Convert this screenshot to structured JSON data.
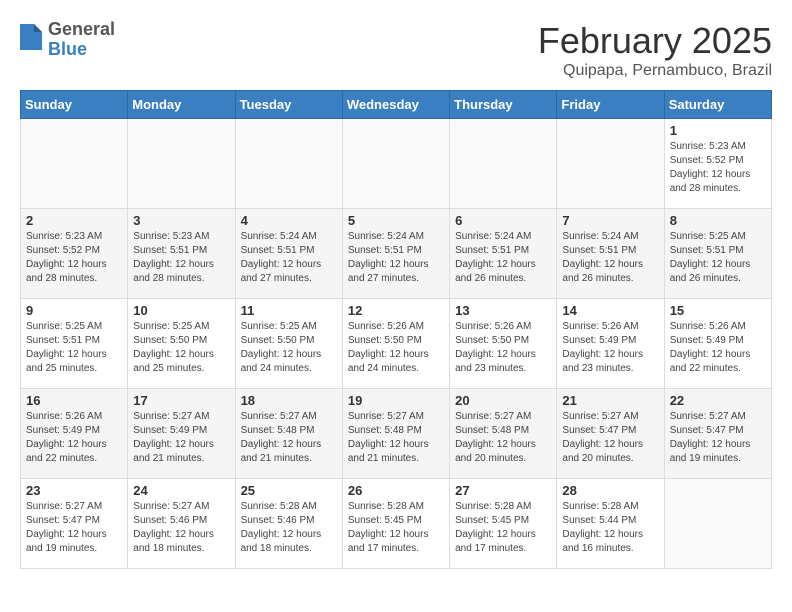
{
  "header": {
    "logo_general": "General",
    "logo_blue": "Blue",
    "month_title": "February 2025",
    "location": "Quipapa, Pernambuco, Brazil"
  },
  "weekdays": [
    "Sunday",
    "Monday",
    "Tuesday",
    "Wednesday",
    "Thursday",
    "Friday",
    "Saturday"
  ],
  "weeks": [
    [
      {
        "day": "",
        "info": ""
      },
      {
        "day": "",
        "info": ""
      },
      {
        "day": "",
        "info": ""
      },
      {
        "day": "",
        "info": ""
      },
      {
        "day": "",
        "info": ""
      },
      {
        "day": "",
        "info": ""
      },
      {
        "day": "1",
        "info": "Sunrise: 5:23 AM\nSunset: 5:52 PM\nDaylight: 12 hours and 28 minutes."
      }
    ],
    [
      {
        "day": "2",
        "info": "Sunrise: 5:23 AM\nSunset: 5:52 PM\nDaylight: 12 hours and 28 minutes."
      },
      {
        "day": "3",
        "info": "Sunrise: 5:23 AM\nSunset: 5:51 PM\nDaylight: 12 hours and 28 minutes."
      },
      {
        "day": "4",
        "info": "Sunrise: 5:24 AM\nSunset: 5:51 PM\nDaylight: 12 hours and 27 minutes."
      },
      {
        "day": "5",
        "info": "Sunrise: 5:24 AM\nSunset: 5:51 PM\nDaylight: 12 hours and 27 minutes."
      },
      {
        "day": "6",
        "info": "Sunrise: 5:24 AM\nSunset: 5:51 PM\nDaylight: 12 hours and 26 minutes."
      },
      {
        "day": "7",
        "info": "Sunrise: 5:24 AM\nSunset: 5:51 PM\nDaylight: 12 hours and 26 minutes."
      },
      {
        "day": "8",
        "info": "Sunrise: 5:25 AM\nSunset: 5:51 PM\nDaylight: 12 hours and 26 minutes."
      }
    ],
    [
      {
        "day": "9",
        "info": "Sunrise: 5:25 AM\nSunset: 5:51 PM\nDaylight: 12 hours and 25 minutes."
      },
      {
        "day": "10",
        "info": "Sunrise: 5:25 AM\nSunset: 5:50 PM\nDaylight: 12 hours and 25 minutes."
      },
      {
        "day": "11",
        "info": "Sunrise: 5:25 AM\nSunset: 5:50 PM\nDaylight: 12 hours and 24 minutes."
      },
      {
        "day": "12",
        "info": "Sunrise: 5:26 AM\nSunset: 5:50 PM\nDaylight: 12 hours and 24 minutes."
      },
      {
        "day": "13",
        "info": "Sunrise: 5:26 AM\nSunset: 5:50 PM\nDaylight: 12 hours and 23 minutes."
      },
      {
        "day": "14",
        "info": "Sunrise: 5:26 AM\nSunset: 5:49 PM\nDaylight: 12 hours and 23 minutes."
      },
      {
        "day": "15",
        "info": "Sunrise: 5:26 AM\nSunset: 5:49 PM\nDaylight: 12 hours and 22 minutes."
      }
    ],
    [
      {
        "day": "16",
        "info": "Sunrise: 5:26 AM\nSunset: 5:49 PM\nDaylight: 12 hours and 22 minutes."
      },
      {
        "day": "17",
        "info": "Sunrise: 5:27 AM\nSunset: 5:49 PM\nDaylight: 12 hours and 21 minutes."
      },
      {
        "day": "18",
        "info": "Sunrise: 5:27 AM\nSunset: 5:48 PM\nDaylight: 12 hours and 21 minutes."
      },
      {
        "day": "19",
        "info": "Sunrise: 5:27 AM\nSunset: 5:48 PM\nDaylight: 12 hours and 21 minutes."
      },
      {
        "day": "20",
        "info": "Sunrise: 5:27 AM\nSunset: 5:48 PM\nDaylight: 12 hours and 20 minutes."
      },
      {
        "day": "21",
        "info": "Sunrise: 5:27 AM\nSunset: 5:47 PM\nDaylight: 12 hours and 20 minutes."
      },
      {
        "day": "22",
        "info": "Sunrise: 5:27 AM\nSunset: 5:47 PM\nDaylight: 12 hours and 19 minutes."
      }
    ],
    [
      {
        "day": "23",
        "info": "Sunrise: 5:27 AM\nSunset: 5:47 PM\nDaylight: 12 hours and 19 minutes."
      },
      {
        "day": "24",
        "info": "Sunrise: 5:27 AM\nSunset: 5:46 PM\nDaylight: 12 hours and 18 minutes."
      },
      {
        "day": "25",
        "info": "Sunrise: 5:28 AM\nSunset: 5:46 PM\nDaylight: 12 hours and 18 minutes."
      },
      {
        "day": "26",
        "info": "Sunrise: 5:28 AM\nSunset: 5:45 PM\nDaylight: 12 hours and 17 minutes."
      },
      {
        "day": "27",
        "info": "Sunrise: 5:28 AM\nSunset: 5:45 PM\nDaylight: 12 hours and 17 minutes."
      },
      {
        "day": "28",
        "info": "Sunrise: 5:28 AM\nSunset: 5:44 PM\nDaylight: 12 hours and 16 minutes."
      },
      {
        "day": "",
        "info": ""
      }
    ]
  ]
}
